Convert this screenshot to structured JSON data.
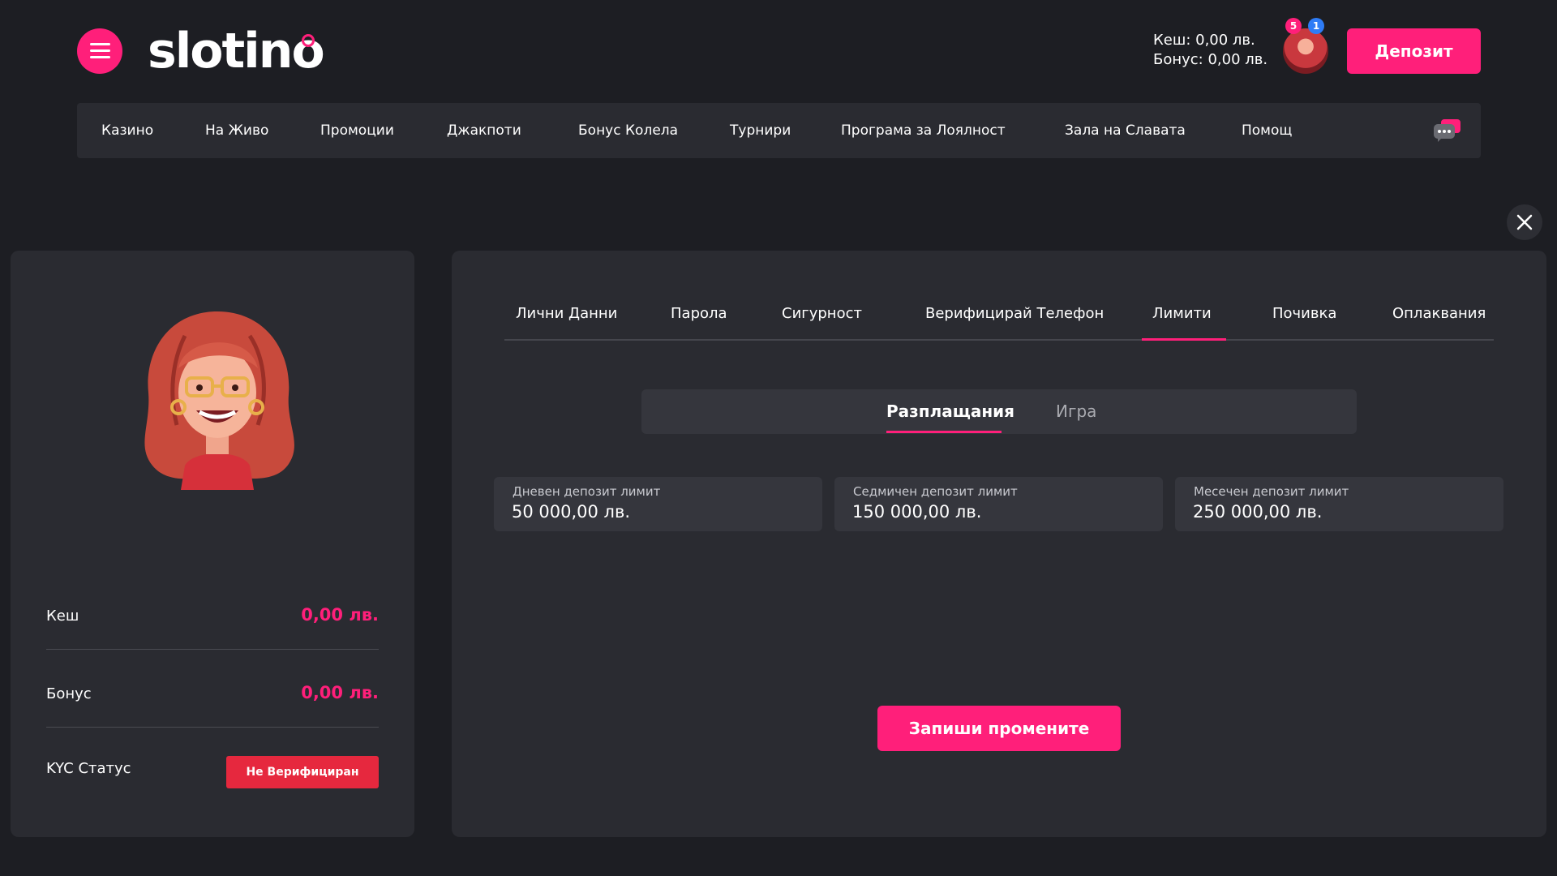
{
  "header": {
    "logo_text": "slotino",
    "cash_line": "Кеш: 0,00 лв.",
    "bonus_line": "Бонус: 0,00 лв.",
    "notifications_count": "5",
    "messages_count": "1",
    "deposit_label": "Депозит"
  },
  "nav": {
    "items": [
      {
        "label": "Казино"
      },
      {
        "label": "На Живо"
      },
      {
        "label": "Промоции"
      },
      {
        "label": "Джакпоти"
      },
      {
        "label": "Бонус Колела"
      },
      {
        "label": "Турнири"
      },
      {
        "label": "Програма за Лоялност"
      },
      {
        "label": "Зала на Славата"
      },
      {
        "label": "Помощ"
      }
    ]
  },
  "profile": {
    "cash_label": "Кеш",
    "cash_value": "0,00 лв.",
    "bonus_label": "Бонус",
    "bonus_value": "0,00 лв.",
    "kyc_label": "KYC Статус",
    "kyc_status": "Не Верифициран"
  },
  "settings": {
    "tabs": [
      {
        "label": "Лични Данни"
      },
      {
        "label": "Парола"
      },
      {
        "label": "Сигурност"
      },
      {
        "label": "Верифицирай Телефон"
      },
      {
        "label": "Лимити"
      },
      {
        "label": "Почивка"
      },
      {
        "label": "Оплаквания"
      }
    ],
    "active_tab": "Лимити",
    "subtabs": [
      {
        "label": "Разплащания"
      },
      {
        "label": "Игра"
      }
    ],
    "active_subtab": "Разплащания",
    "limits": [
      {
        "label": "Дневен депозит лимит",
        "value": "50 000,00 лв."
      },
      {
        "label": "Седмичен депозит лимит",
        "value": "150 000,00 лв."
      },
      {
        "label": "Месечен депозит лимит",
        "value": "250 000,00 лв."
      }
    ],
    "save_label": "Запиши промените"
  },
  "colors": {
    "accent": "#ff1f7a",
    "background": "#1d1e23",
    "panel": "#2a2b31",
    "field": "#35363d",
    "kyc_badge": "#e6283e",
    "badge_blue": "#2e7cf6"
  },
  "icons": {
    "menu": "hamburger-icon",
    "chat": "chat-bubble-icon",
    "close": "close-icon"
  }
}
